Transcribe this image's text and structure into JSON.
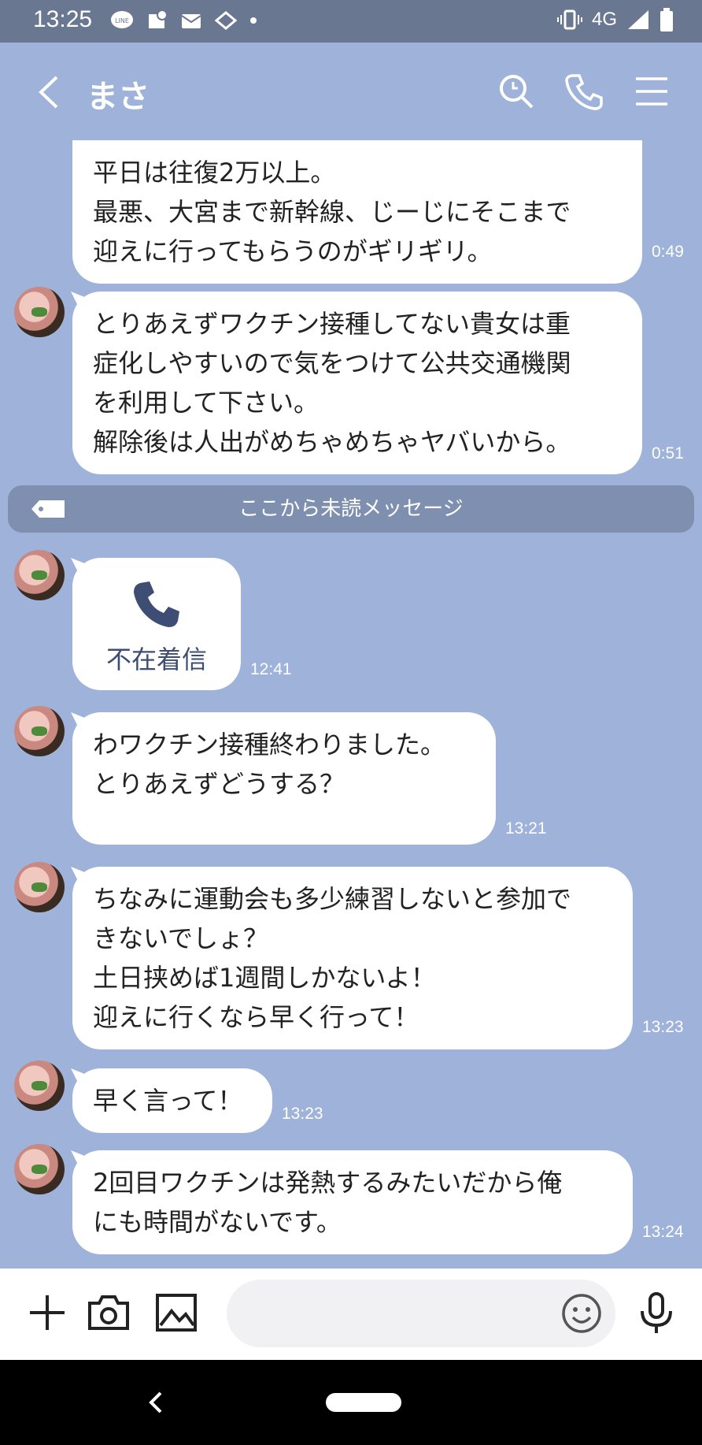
{
  "status_bar": {
    "time": "13:25",
    "network": "4G",
    "icons": [
      "line-app-icon",
      "notification-icon",
      "mail-icon",
      "cast-icon",
      "dot-icon",
      "vibrate-icon",
      "signal-icon",
      "battery-icon"
    ]
  },
  "header": {
    "title": "まさ",
    "icons": [
      "back-icon",
      "search-icon",
      "phone-icon",
      "menu-icon"
    ]
  },
  "messages": [
    {
      "lines": [
        "平日は往復2万以上。",
        "最悪、大宮まで新幹線、じーじにそこまで",
        "迎えに行ってもらうのがギリギリ。"
      ],
      "time": "0:49"
    },
    {
      "lines": [
        "とりあえずワクチン接種してない貴女は重",
        "症化しやすいので気をつけて公共交通機関",
        "を利用して下さい。",
        "解除後は人出がめちゃめちゃヤバいから。"
      ],
      "time": "0:51"
    },
    {
      "lines": [
        "わワクチン接種終わりました。",
        "とりあえずどうする？"
      ],
      "time": "13:21"
    },
    {
      "lines": [
        "ちなみに運動会も多少練習しないと参加で",
        "きないでしょ？",
        "土日挟めば1週間しかないよ！",
        "迎えに行くなら早く行って！"
      ],
      "time": "13:23"
    },
    {
      "lines": [
        "早く言って！"
      ],
      "time": "13:23"
    },
    {
      "lines": [
        "2回目ワクチンは発熱するみたいだから俺",
        "にも時間がないです。"
      ],
      "time": "13:24"
    }
  ],
  "unread_divider": {
    "label": "ここから未読メッセージ"
  },
  "missed_call": {
    "label": "不在着信",
    "time": "12:41"
  },
  "input_bar": {
    "placeholder": ""
  }
}
